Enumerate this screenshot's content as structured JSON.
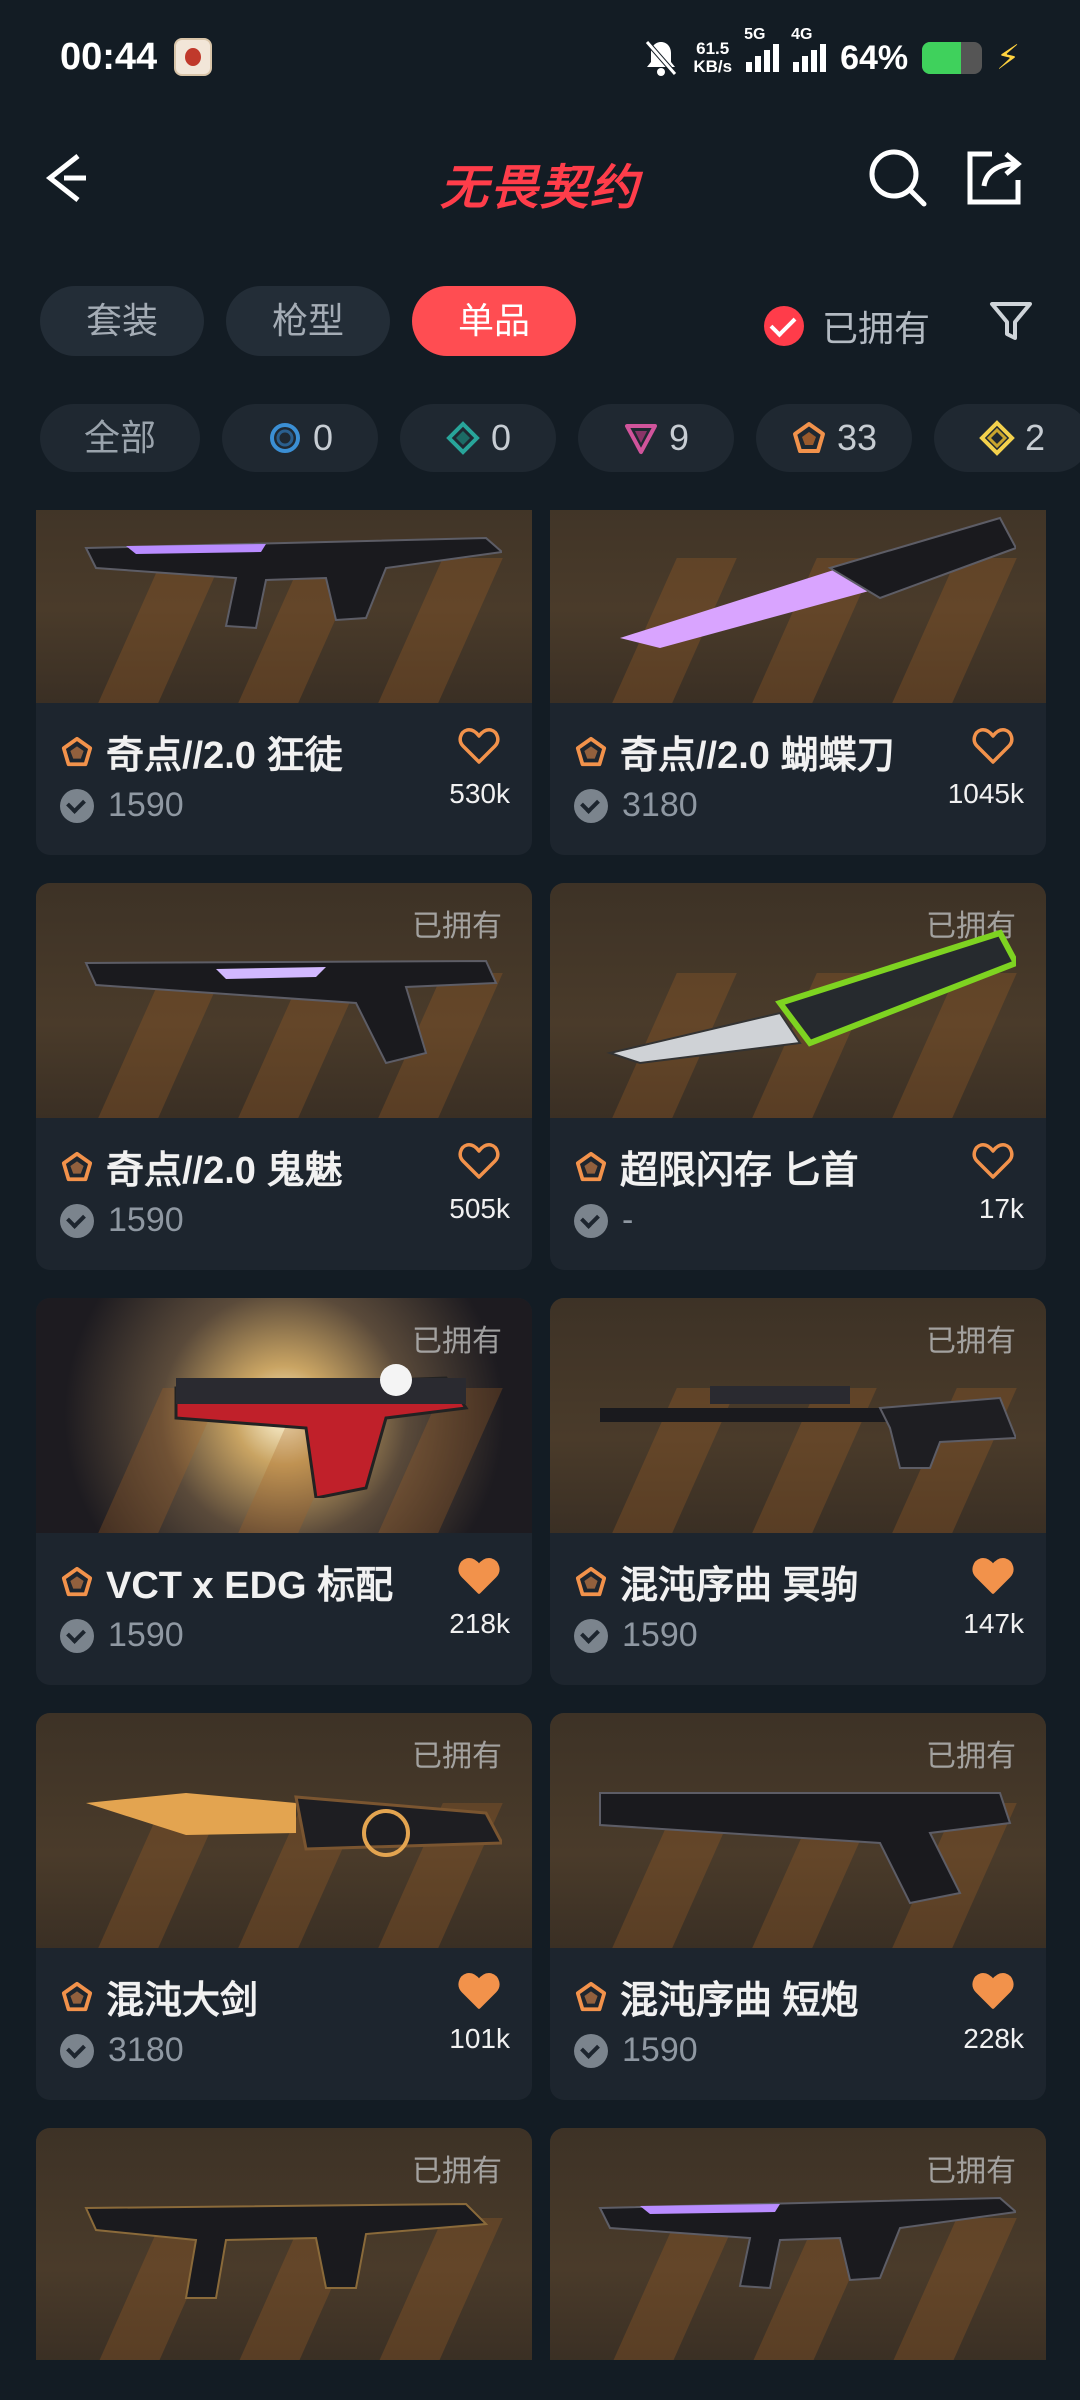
{
  "status_bar": {
    "time": "00:44",
    "net_speed_value": "61.5",
    "net_speed_unit": "KB/s",
    "net1_label": "5G",
    "net2_label": "4G",
    "battery_percent": "64%",
    "battery_level": 0.64
  },
  "header": {
    "title": "无畏契约"
  },
  "tabs": [
    {
      "label": "套装",
      "active": false
    },
    {
      "label": "枪型",
      "active": false
    },
    {
      "label": "单品",
      "active": true
    }
  ],
  "owned_filter": {
    "label": "已拥有",
    "checked": true
  },
  "rarity_filters": [
    {
      "label": "全部",
      "count": ""
    },
    {
      "icon": "select-tier-icon",
      "color": "#3b8fd4",
      "count": "0"
    },
    {
      "icon": "deluxe-tier-icon",
      "color": "#28a59a",
      "count": "0"
    },
    {
      "icon": "premium-tier-icon",
      "color": "#d0549b",
      "count": "9"
    },
    {
      "icon": "exclusive-tier-icon",
      "color": "#f2924b",
      "count": "33"
    },
    {
      "icon": "ultra-tier-icon",
      "color": "#f3d14d",
      "count": "2"
    }
  ],
  "items": [
    {
      "name": "奇点//2.0 狂徒",
      "price": "1590",
      "likes": "530k",
      "owned_label": "",
      "favorited": false,
      "tier_color": "#f2924b",
      "weapon_icon": "rifle-icon"
    },
    {
      "name": "奇点//2.0 蝴蝶刀",
      "price": "3180",
      "likes": "1045k",
      "owned_label": "",
      "favorited": false,
      "tier_color": "#f2924b",
      "weapon_icon": "knife-icon"
    },
    {
      "name": "奇点//2.0 鬼魅",
      "price": "1590",
      "likes": "505k",
      "owned_label": "已拥有",
      "favorited": false,
      "tier_color": "#f2924b",
      "weapon_icon": "pistol-icon"
    },
    {
      "name": "超限闪存 匕首",
      "price": "-",
      "likes": "17k",
      "owned_label": "已拥有",
      "favorited": false,
      "tier_color": "#f2924b",
      "weapon_icon": "dagger-icon"
    },
    {
      "name": "VCT x EDG 标配",
      "price": "1590",
      "likes": "218k",
      "owned_label": "已拥有",
      "favorited": true,
      "tier_color": "#f2924b",
      "weapon_icon": "edg-pistol-icon"
    },
    {
      "name": "混沌序曲 冥驹",
      "price": "1590",
      "likes": "147k",
      "owned_label": "已拥有",
      "favorited": true,
      "tier_color": "#f2924b",
      "weapon_icon": "sniper-icon"
    },
    {
      "name": "混沌大剑",
      "price": "3180",
      "likes": "101k",
      "owned_label": "已拥有",
      "favorited": true,
      "tier_color": "#f2924b",
      "weapon_icon": "greatsword-icon"
    },
    {
      "name": "混沌序曲 短炮",
      "price": "1590",
      "likes": "228k",
      "owned_label": "已拥有",
      "favorited": true,
      "tier_color": "#f2924b",
      "weapon_icon": "shotgun-icon"
    },
    {
      "name": "",
      "price": "",
      "likes": "",
      "owned_label": "已拥有",
      "favorited": false,
      "tier_color": "#f2924b",
      "weapon_icon": "smg-icon"
    },
    {
      "name": "",
      "price": "",
      "likes": "",
      "owned_label": "已拥有",
      "favorited": false,
      "tier_color": "#f2924b",
      "weapon_icon": "rifle-icon"
    }
  ]
}
